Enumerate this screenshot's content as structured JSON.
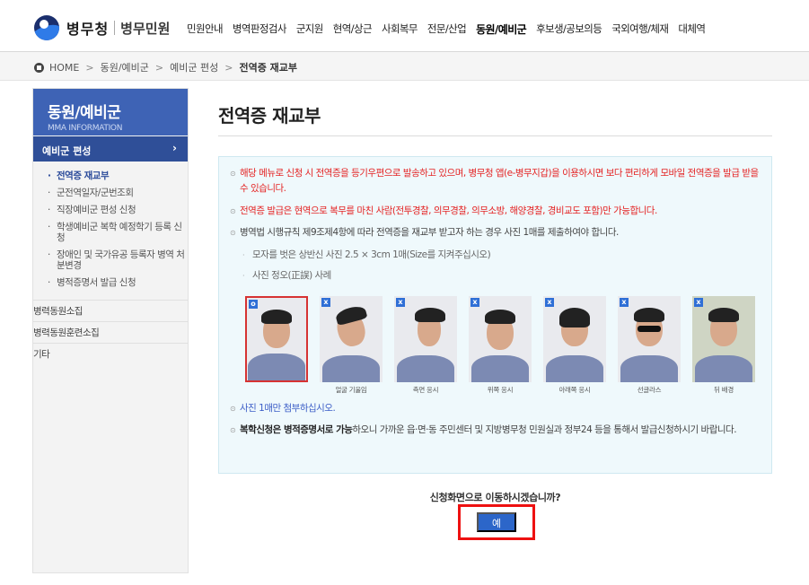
{
  "header": {
    "logo_text": "병무청",
    "logo_sub": "병무민원",
    "gnb": [
      {
        "label": "민원안내",
        "active": false
      },
      {
        "label": "병역판정검사",
        "active": false
      },
      {
        "label": "군지원",
        "active": false
      },
      {
        "label": "현역/상근",
        "active": false
      },
      {
        "label": "사회복무",
        "active": false
      },
      {
        "label": "전문/산업",
        "active": false
      },
      {
        "label": "동원/예비군",
        "active": true
      },
      {
        "label": "후보생/공보의등",
        "active": false
      },
      {
        "label": "국외여행/체재",
        "active": false
      },
      {
        "label": "대체역",
        "active": false
      }
    ]
  },
  "breadcrumb": {
    "home": "HOME",
    "items": [
      "동원/예비군",
      "예비군 편성"
    ],
    "current": "전역증 재교부"
  },
  "sidebar": {
    "title": "동원/예비군",
    "subtitle": "MMA INFORMATION",
    "section": "예비군 편성",
    "items": [
      {
        "label": "전역증 재교부",
        "active": true
      },
      {
        "label": "군전역일자/군번조회",
        "active": false
      },
      {
        "label": "직장예비군 편성 신청",
        "active": false
      },
      {
        "label": "학생예비군 복학 예정학기 등록 신청",
        "active": false
      },
      {
        "label": "장애인 및 국가유공 등록자 병역 처분변경",
        "active": false
      },
      {
        "label": "병적증명서 발급 신청",
        "active": false
      }
    ],
    "groups": [
      "병력동원소집",
      "병력동원훈련소집",
      "기타"
    ]
  },
  "main": {
    "title": "전역증 재교부",
    "notes": {
      "n1": "해당 메뉴로 신청 시 전역증을 등기우편으로 발송하고 있으며, 병무청 앱(e-병무지갑)을 이용하시면 보다 편리하게 모바일 전역증을 발급 받을 수 있습니다.",
      "n2": "전역증 발급은 현역으로 복무를 마친 사람(전투경찰, 의무경찰, 의무소방, 해양경찰, 경비교도 포함)만 가능합니다.",
      "n3": "병역법 시행규칙 제9조제4항에 따라 전역증을 재교부 받고자 하는 경우 사진 1매를 제출하여야 합니다.",
      "n3a": "모자를 벗은 상반신 사진 2.5 × 3cm 1매(Size를 지켜주십시오)",
      "n3b": "사진 정오(正誤) 사례",
      "n4": "사진 1매만 첨부하십시오.",
      "n5_bold": "복학신청은 병적증명서로 가능",
      "n5_rest": "하오니 가까운 읍·면·동 주민센터 및 지방병무청 민원실과 정부24 등을 통해서 발급신청하시기 바랍니다."
    },
    "photos": [
      {
        "mark": "o",
        "caption": ""
      },
      {
        "mark": "x",
        "caption": "얼굴 기울임"
      },
      {
        "mark": "x",
        "caption": "측면 응시"
      },
      {
        "mark": "x",
        "caption": "위쪽 응시"
      },
      {
        "mark": "x",
        "caption": "아래쪽 응시"
      },
      {
        "mark": "x",
        "caption": "선글라스"
      },
      {
        "mark": "x",
        "caption": "뒤 배경"
      }
    ],
    "confirm_question": "신청화면으로 이동하시겠습니까?",
    "yes_button": "예"
  },
  "colors": {
    "accent": "#3e63b5",
    "section": "#2f4f98",
    "warning": "#e42323",
    "button": "#2c66c9",
    "highlight": "#ee1111"
  }
}
